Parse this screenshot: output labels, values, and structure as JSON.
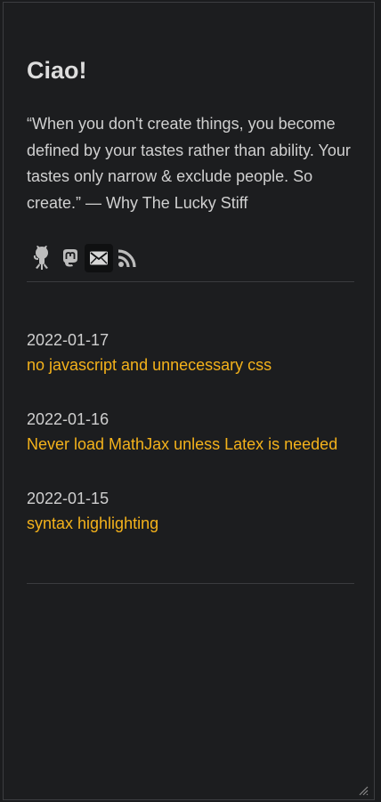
{
  "header": {
    "title": "Ciao!",
    "quote": "“When you don't create things, you become defined by your tastes rather than ability. Your tastes only narrow & exclude people. So create.” — Why The Lucky Stiff"
  },
  "social_links": [
    {
      "name": "github",
      "icon": "github-icon"
    },
    {
      "name": "mastodon",
      "icon": "mastodon-icon"
    },
    {
      "name": "email",
      "icon": "mail-icon"
    },
    {
      "name": "rss",
      "icon": "rss-icon"
    }
  ],
  "posts": [
    {
      "date": "2022-01-17",
      "title": "no javascript and unnecessary css"
    },
    {
      "date": "2022-01-16",
      "title": "Never load MathJax unless Latex is needed"
    },
    {
      "date": "2022-01-15",
      "title": "syntax highlighting"
    }
  ],
  "colors": {
    "background": "#1c1d1f",
    "text": "#d4d4d4",
    "link": "#f4b21b",
    "rule": "#3a3b3e"
  }
}
